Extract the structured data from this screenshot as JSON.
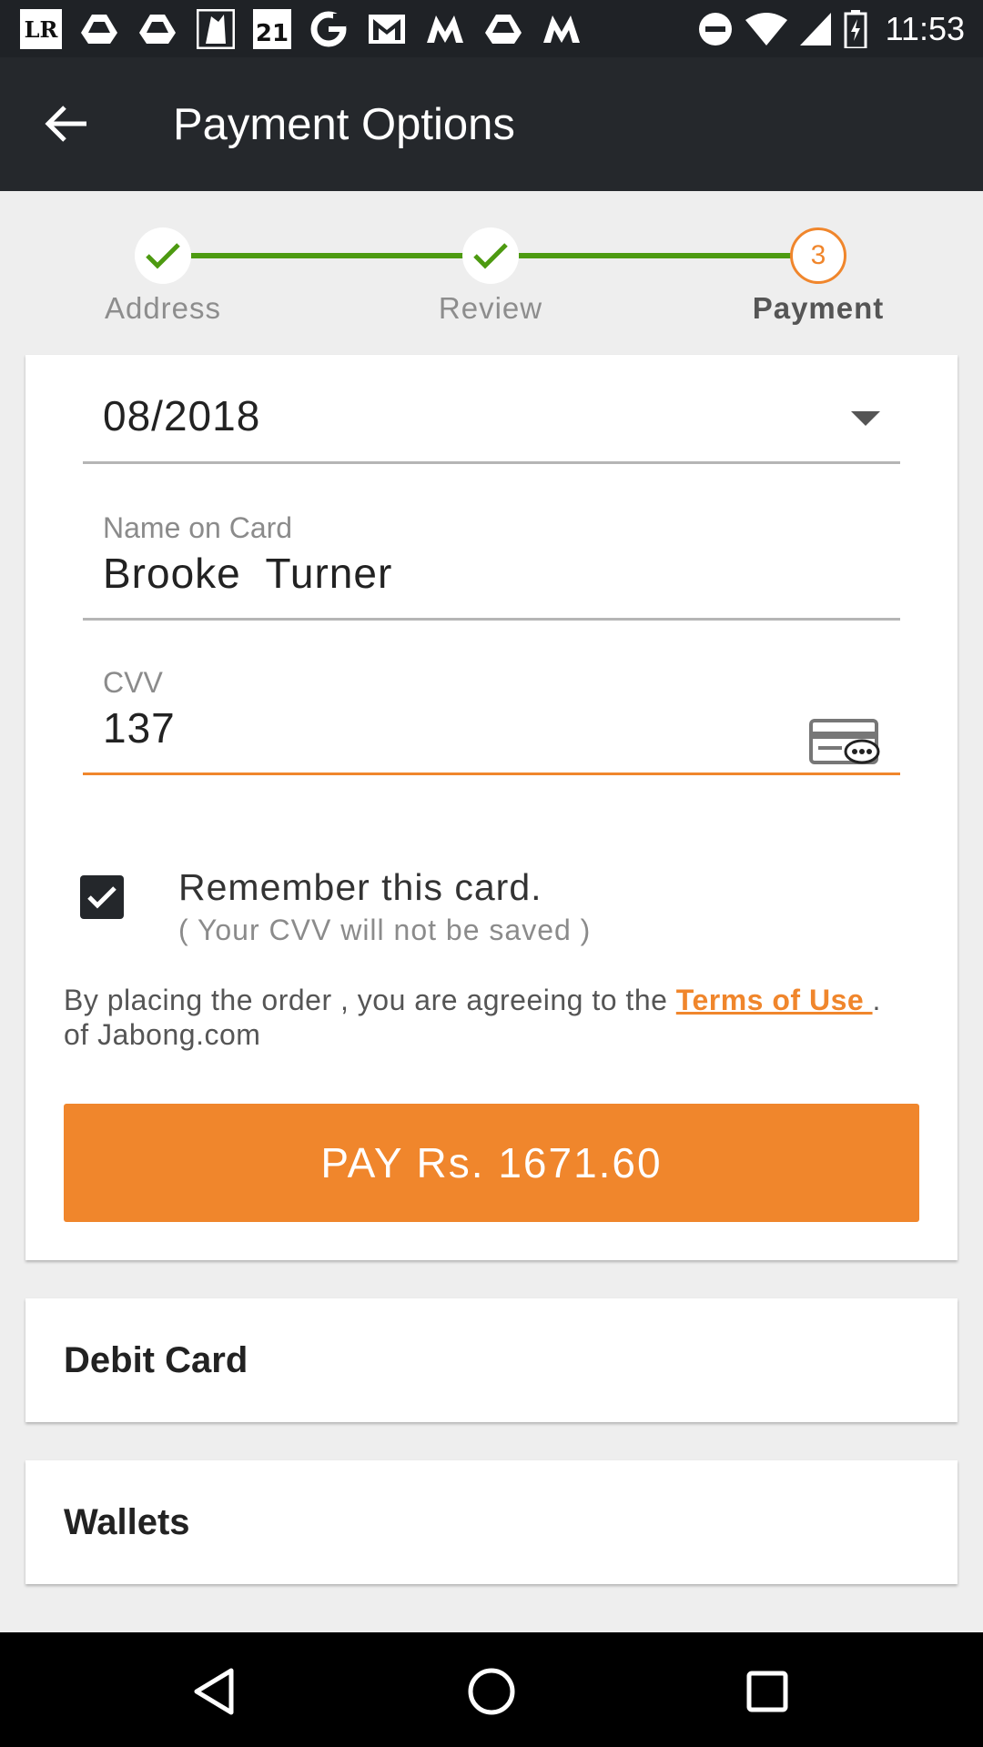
{
  "status_bar": {
    "time": "11:53",
    "lr_label": "LR",
    "forever21_label": "21",
    "notification_icons": [
      "lr-app-icon",
      "drive-icon",
      "drive-icon",
      "app-icon",
      "forever21-icon",
      "google-icon",
      "gmail-icon",
      "myntra-icon",
      "drive-icon",
      "myntra-icon"
    ],
    "system_icons": [
      "do-not-disturb-icon",
      "wifi-icon",
      "cell-signal-icon",
      "battery-charging-icon"
    ]
  },
  "app_bar": {
    "title": "Payment Options",
    "back_icon": "arrow-back-icon"
  },
  "stepper": {
    "steps": [
      {
        "label": "Address",
        "state": "done"
      },
      {
        "label": "Review",
        "state": "done"
      },
      {
        "label": "Payment",
        "state": "active",
        "number": "3"
      }
    ],
    "colors": {
      "done": "#4d9a11",
      "active": "#f0862c"
    }
  },
  "card_form": {
    "expiry": {
      "value": "08/2018"
    },
    "name_on_card": {
      "label": "Name on Card",
      "value": "Brooke  Turner"
    },
    "cvv": {
      "label": "CVV",
      "value": "137"
    },
    "remember": {
      "checked": true,
      "label": "Remember this card.",
      "sublabel": "( Your CVV will not be saved )"
    },
    "terms": {
      "prefix": "By placing the order , you are agreeing to the ",
      "link": "Terms of Use ",
      "suffix": ". of Jabong.com"
    },
    "pay_button": "PAY Rs. 1671.60"
  },
  "options": {
    "debit_card": "Debit Card",
    "wallets": "Wallets"
  },
  "colors": {
    "accent": "#f0862c",
    "success": "#4d9a11",
    "app_bar": "#25282c"
  }
}
